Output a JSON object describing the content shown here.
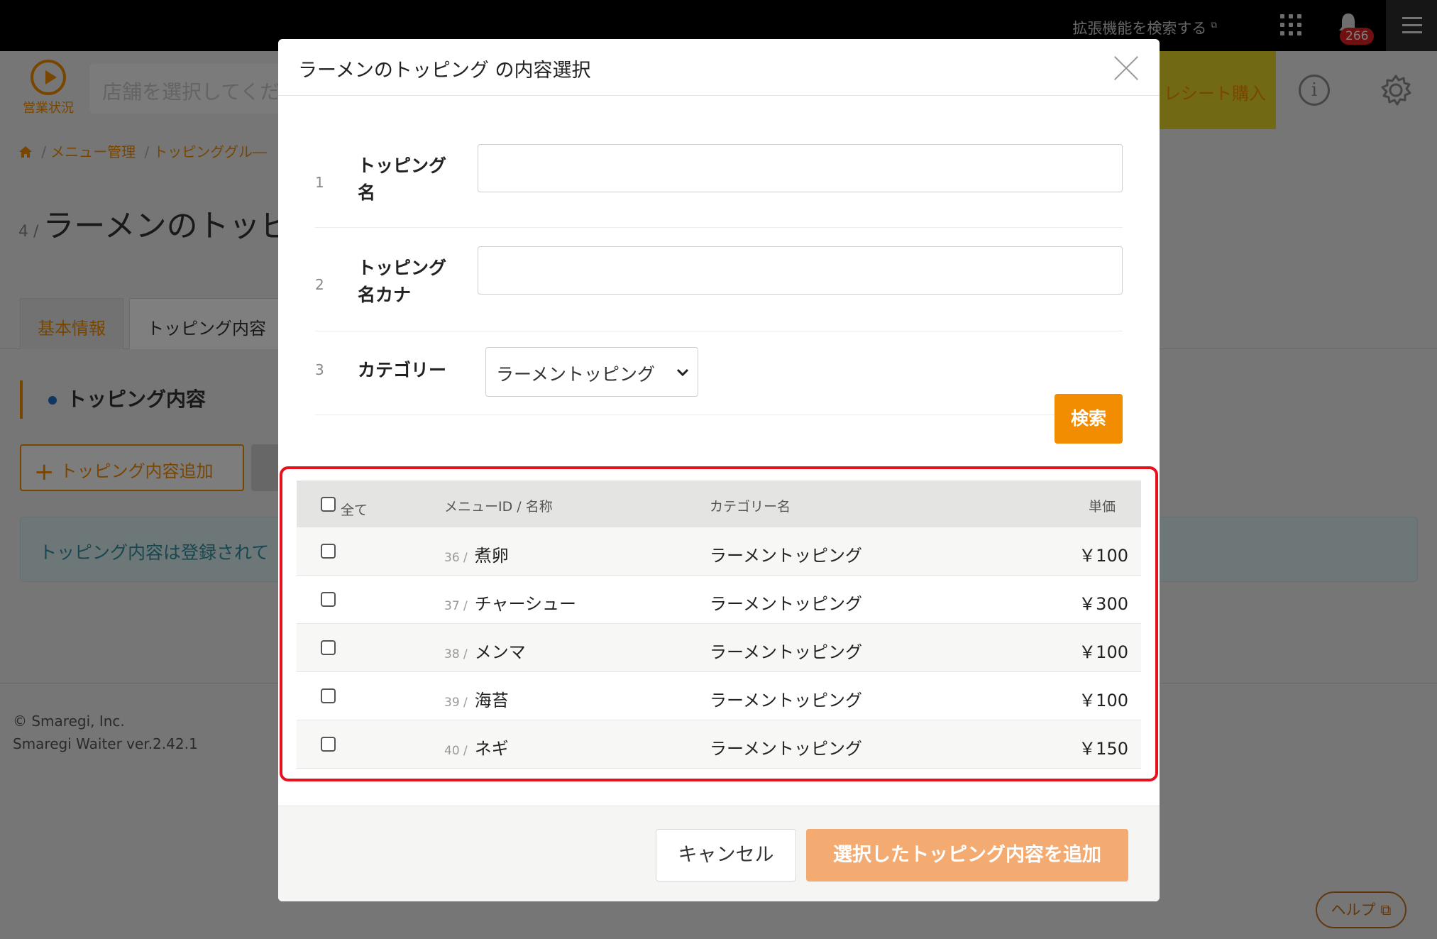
{
  "topbar": {
    "extension_search": "拡張機能を検索する",
    "notification_count": "266"
  },
  "header": {
    "status_label": "営業状況",
    "store_placeholder": "店舗を選択してくだ",
    "receipt_label": "レシート購入"
  },
  "breadcrumb": [
    "メニュー管理",
    "トッピンググル―"
  ],
  "page": {
    "title_number": "4 /",
    "title": "ラーメンのトッピ",
    "tabs": [
      "基本情報",
      "トッピング内容"
    ],
    "section_title": "トッピング内容",
    "add_button": "トッピング内容追加",
    "notice": "トッピング内容は登録されて"
  },
  "footer": {
    "copyright": "© Smaregi, Inc.",
    "version": "Smaregi Waiter ver.2.42.1",
    "help": "ヘルプ"
  },
  "modal": {
    "title": "ラーメンのトッピング の内容選択",
    "fields": [
      {
        "no": "1",
        "label": "トッピング名",
        "value": ""
      },
      {
        "no": "2",
        "label": "トッピング名カナ",
        "value": ""
      },
      {
        "no": "3",
        "label": "カテゴリー",
        "value": "ラーメントッピング"
      }
    ],
    "search_button": "検索",
    "table": {
      "headers": {
        "all": "全て",
        "id_name": "メニューID / 名称",
        "category": "カテゴリー名",
        "price": "単価"
      },
      "rows": [
        {
          "id": "36 /",
          "name": "煮卵",
          "category": "ラーメントッピング",
          "price": "￥100"
        },
        {
          "id": "37 /",
          "name": "チャーシュー",
          "category": "ラーメントッピング",
          "price": "￥300"
        },
        {
          "id": "38 /",
          "name": "メンマ",
          "category": "ラーメントッピング",
          "price": "￥100"
        },
        {
          "id": "39 /",
          "name": "海苔",
          "category": "ラーメントッピング",
          "price": "￥100"
        },
        {
          "id": "40 /",
          "name": "ネギ",
          "category": "ラーメントッピング",
          "price": "￥150"
        }
      ]
    },
    "cancel_button": "キャンセル",
    "confirm_button": "選択したトッピング内容を追加"
  },
  "colors": {
    "accent": "#f28c00",
    "highlight_frame": "#e8101c",
    "confirm_disabled": "#f4ab72"
  }
}
